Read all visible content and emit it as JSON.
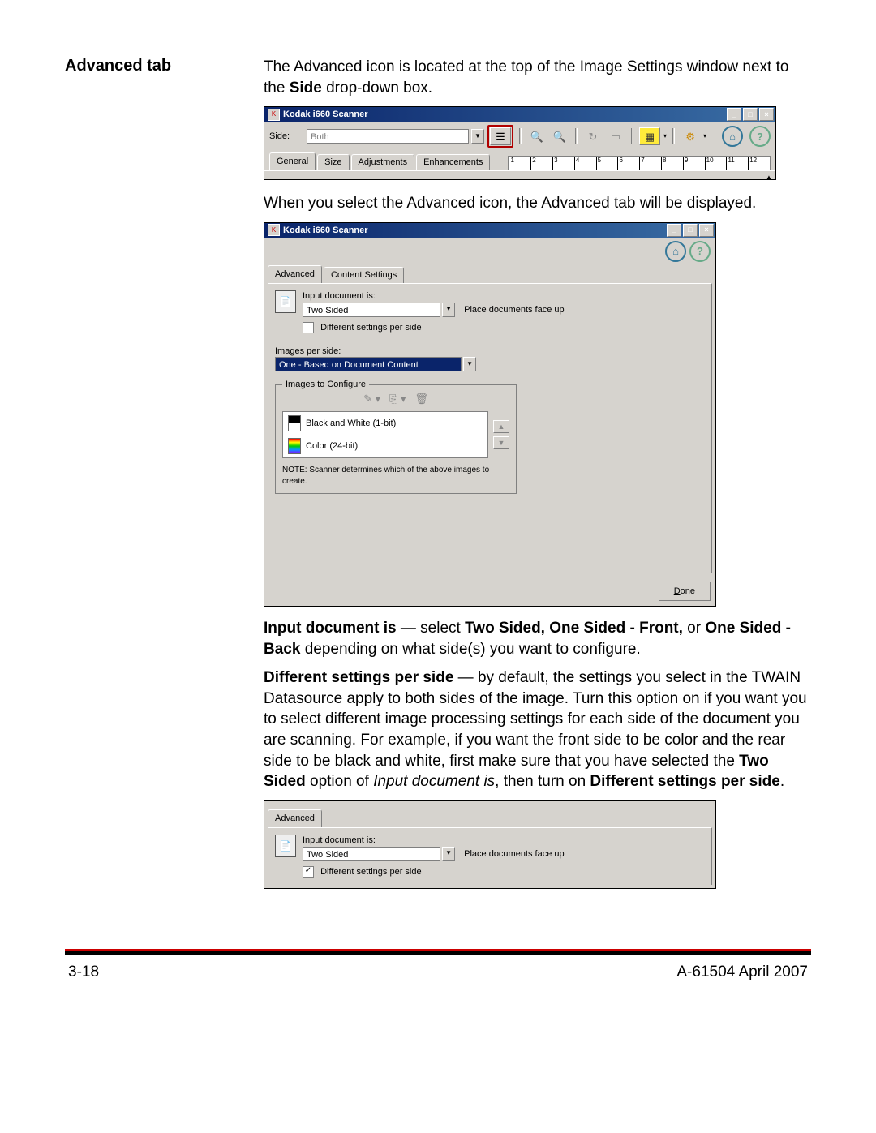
{
  "heading": "Advanced tab",
  "intro_1a": "The Advanced icon is located at the top of the Image Settings window next to the ",
  "intro_1b": "Side",
  "intro_1c": " drop-down box.",
  "intro_2": "When you select the Advanced icon, the Advanced tab will be displayed.",
  "win1": {
    "title": "Kodak i660 Scanner",
    "side_label": "Side:",
    "side_value": "Both",
    "tabs": [
      "General",
      "Size",
      "Adjustments",
      "Enhancements"
    ],
    "ruler_ticks": [
      "1",
      "2",
      "3",
      "4",
      "5",
      "6",
      "7",
      "8",
      "9",
      "10",
      "11",
      "12"
    ]
  },
  "win2": {
    "title": "Kodak i660 Scanner",
    "tabs": {
      "advanced": "Advanced",
      "content": "Content Settings"
    },
    "input_doc_label": "Input document is:",
    "input_doc_value": "Two Sided",
    "place_docs": "Place documents face up",
    "diff_label": "Different settings per side",
    "images_per_side_label": "Images per side:",
    "images_per_side_value": "One - Based on Document Content",
    "configure_legend": "Images to Configure",
    "item_bw": "Black and White (1-bit)",
    "item_color": "Color (24-bit)",
    "note": "NOTE: Scanner determines which of the above images to create.",
    "done": "Done"
  },
  "para2_a": "Input document is",
  "para2_b": " — select ",
  "para2_c": "Two Sided, One Sided - Front,",
  "para2_d": " or ",
  "para2_e": "One Sided - Back",
  "para2_f": " depending on what side(s) you want to configure.",
  "para3_a": "Different settings per side",
  "para3_b": " — by default, the settings you select in the TWAIN Datasource apply to both sides of the image. Turn this option on if you want you to select different image processing settings for each side of the document you are scanning. For example, if you want the front side to be color and the rear side to be black and white, first make sure that you have selected the ",
  "para3_c": "Two Sided",
  "para3_d": " option of ",
  "para3_e": "Input document is",
  "para3_f": ", then turn on ",
  "para3_g": "Different settings per side",
  "para3_h": ".",
  "win3": {
    "tab": "Advanced",
    "input_doc_label": "Input document is:",
    "input_doc_value": "Two Sided",
    "place_docs": "Place documents face up",
    "diff_label": "Different settings per side",
    "checked": "✓"
  },
  "footer_left": "3-18",
  "footer_right": "A-61504  April 2007"
}
